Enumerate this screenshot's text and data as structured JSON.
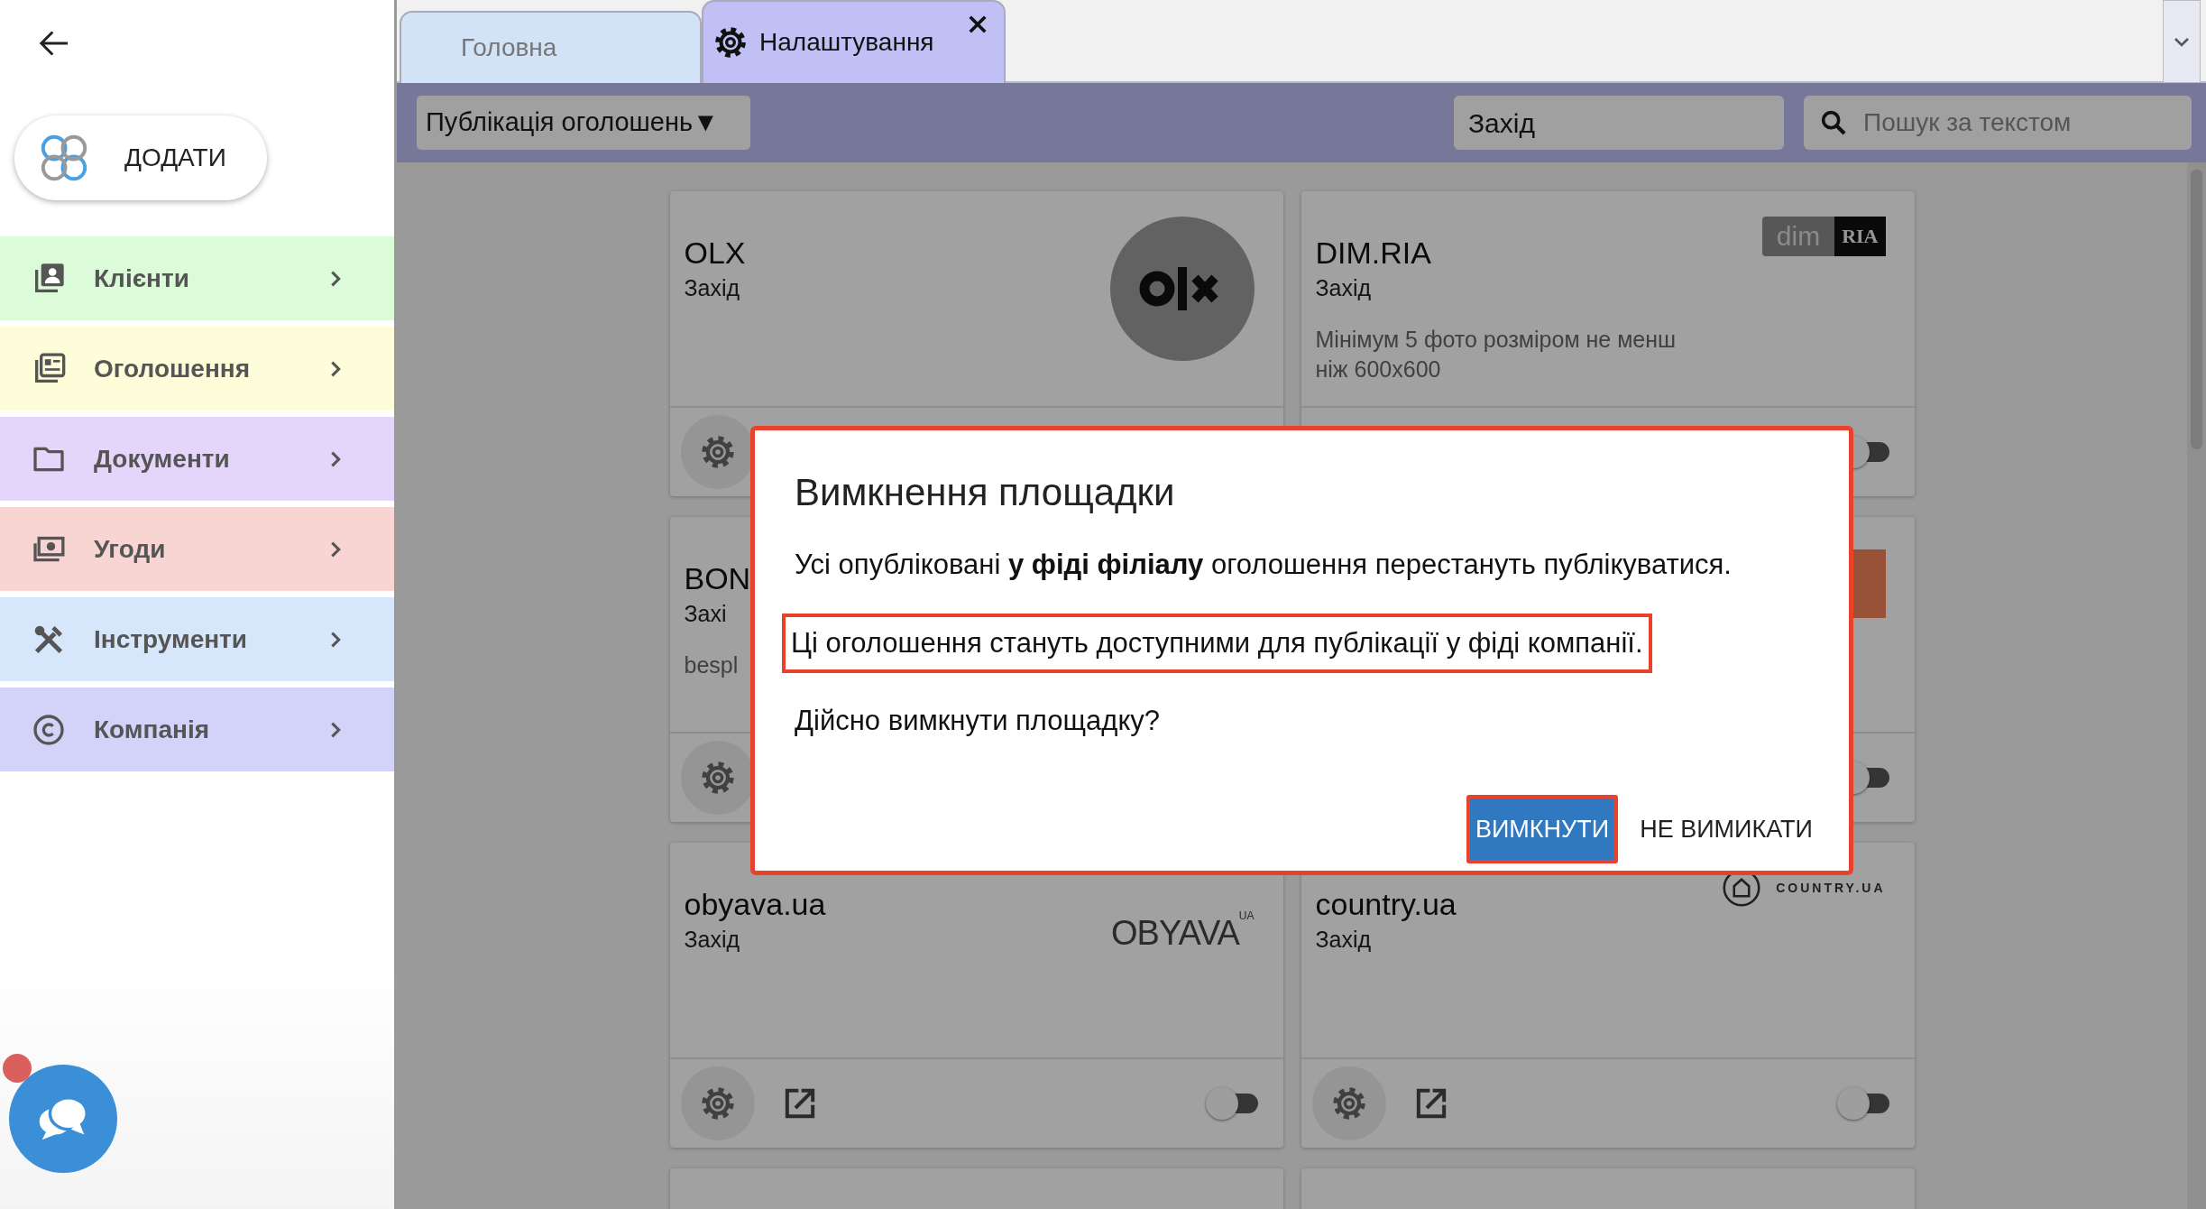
{
  "sidebar": {
    "add_button": {
      "label": "ДОДАТИ"
    },
    "menu": [
      {
        "label": "Клієнти",
        "kind": "contacts",
        "color": "#dcfbd9"
      },
      {
        "label": "Оголошення",
        "kind": "news",
        "color": "#fdfdd9"
      },
      {
        "label": "Документи",
        "kind": "folder",
        "color": "#e4d6fb"
      },
      {
        "label": "Угоди",
        "kind": "money",
        "color": "#f8d5d3"
      },
      {
        "label": "Інструменти",
        "kind": "tools",
        "color": "#d6e7fb"
      },
      {
        "label": "Компанія",
        "kind": "copyright",
        "color": "#d3d3f9"
      }
    ],
    "chat": {
      "unread": true
    }
  },
  "tabs": [
    {
      "label": "Головна",
      "selected": false,
      "closable": false
    },
    {
      "label": "Налаштування",
      "selected": true,
      "closable": true,
      "kind": "settings"
    }
  ],
  "toolbar": {
    "section": {
      "label": "Публікація оголошень",
      "caret": "▼"
    },
    "region": {
      "value": "Захід"
    },
    "search": {
      "placeholder": "Пошук за текстом"
    }
  },
  "cards": [
    {
      "kind": "platform",
      "title": "OLX",
      "region": "Захід",
      "logo": {
        "kind": "olx"
      },
      "controls": [
        {
          "kind": "settings"
        }
      ]
    },
    {
      "kind": "platform",
      "title": "DIM.RIA",
      "region": "Захід",
      "note": "Мінімум 5 фото розміром не менш ніж 600x600",
      "logo": {
        "kind": "dimria",
        "texts": [
          "dim",
          "RIA"
        ]
      },
      "controls": [
        {
          "kind": "toggle",
          "on": false
        }
      ]
    },
    {
      "kind": "platform",
      "title": "BON",
      "region": "Захі",
      "note": "bespl",
      "controls": [
        {
          "kind": "settings"
        }
      ]
    },
    {
      "kind": "platform",
      "logo": {
        "kind": "block"
      },
      "controls": [
        {
          "kind": "toggle",
          "on": false
        }
      ]
    },
    {
      "kind": "platform",
      "title": "obyava.ua",
      "region": "Захід",
      "logo": {
        "kind": "obyava",
        "texts": [
          "OBYAVA",
          "UA"
        ]
      },
      "controls": [
        {
          "kind": "settings"
        },
        {
          "kind": "open-link"
        },
        {
          "kind": "toggle",
          "on": false
        }
      ]
    },
    {
      "kind": "platform",
      "title": "country.ua",
      "region": "Захід",
      "logo": {
        "kind": "country",
        "texts": [
          "COUNTRY.UA"
        ]
      },
      "controls": [
        {
          "kind": "settings"
        },
        {
          "kind": "open-link"
        },
        {
          "kind": "toggle",
          "on": false
        }
      ]
    },
    {
      "kind": "blank"
    },
    {
      "kind": "blank"
    }
  ],
  "dialog": {
    "title": "Вимкнення площадки",
    "highlighted": true,
    "paragraphs": [
      {
        "text": "Усі опубліковані **у фіді філіалу** оголошення перестануть публікуватися.",
        "highlighted": false
      },
      {
        "text": "Ці оголошення стануть доступними для публікації у фіді компанії.",
        "highlighted": true
      },
      {
        "text": "Дійсно вимкнути площадку?",
        "highlighted": false
      }
    ],
    "buttons": [
      {
        "label": "ВИМКНУТИ",
        "kind": "primary",
        "highlighted": true
      },
      {
        "label": "НЕ ВИМИКАТИ",
        "kind": "text",
        "highlighted": false
      }
    ]
  }
}
